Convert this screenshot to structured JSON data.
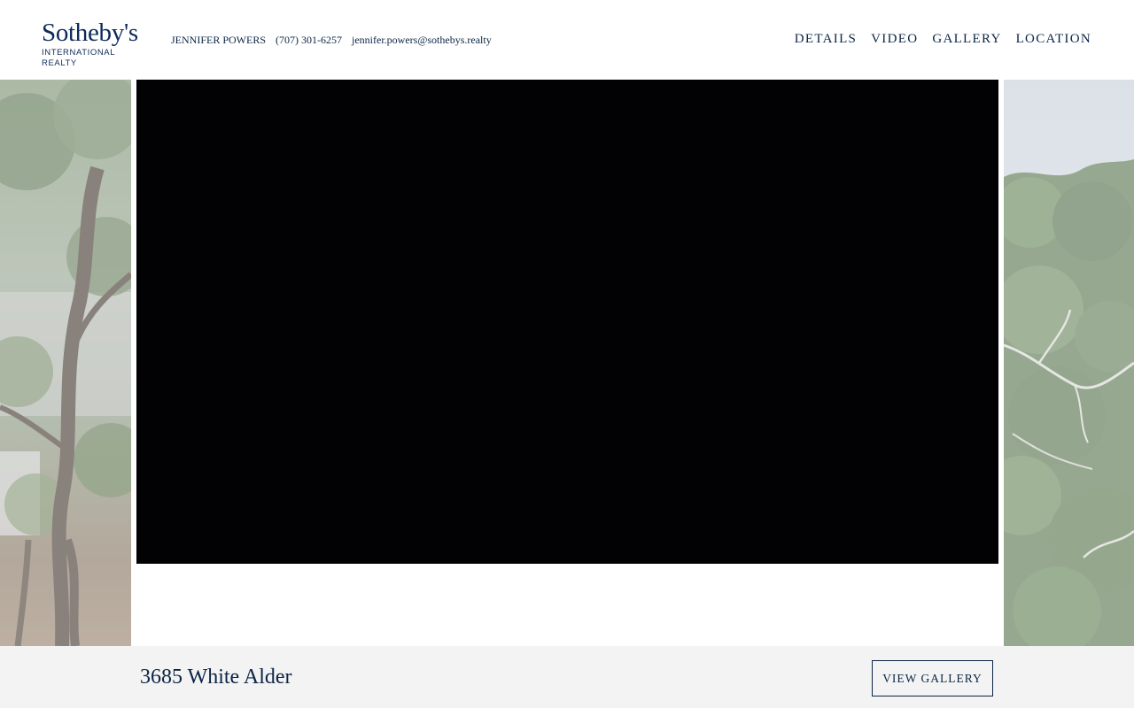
{
  "brand": {
    "name": "Sotheby's",
    "subtitle": "INTERNATIONAL REALTY",
    "color": "#0e2a5a"
  },
  "contact": {
    "agent": "JENNIFER POWERS",
    "phone": "(707) 301-6257",
    "email": "jennifer.powers@sothebys.realty"
  },
  "nav": {
    "items": [
      {
        "label": "DETAILS"
      },
      {
        "label": "VIDEO"
      },
      {
        "label": "GALLERY"
      },
      {
        "label": "LOCATION"
      }
    ]
  },
  "hero": {
    "left_image": "forest-trees-photo",
    "right_image": "oak-hillside-photo",
    "video_player": "video-player"
  },
  "footer": {
    "address": "3685 White Alder",
    "gallery_button": "VIEW GALLERY",
    "background": "#f3f3f3"
  },
  "colors": {
    "accent": "#0b2545",
    "video_bg": "#020205"
  }
}
